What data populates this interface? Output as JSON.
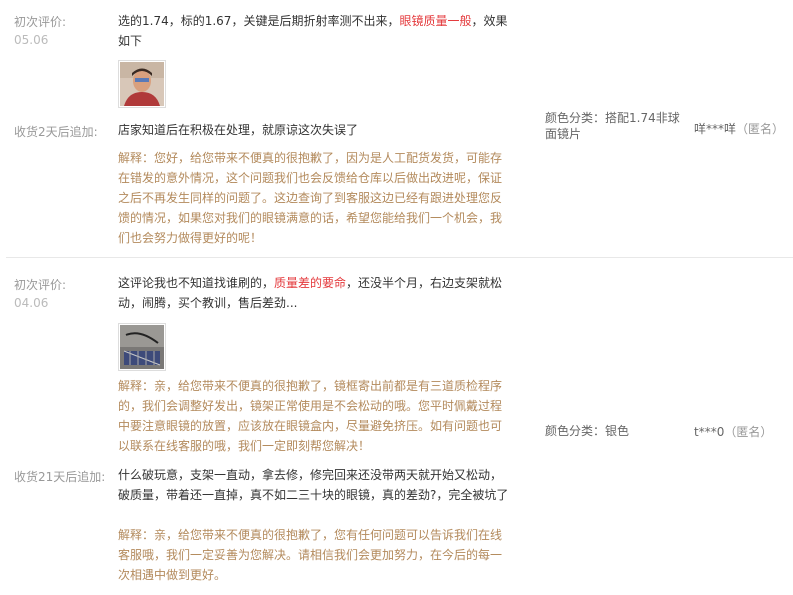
{
  "reviews": [
    {
      "initial_label": "初次评价:",
      "date": "05.06",
      "content_before": "选的1.74，标的1.67，关键是后期折射率测不出来，",
      "content_highlight": "眼镜质量一般",
      "content_after": "，效果如下",
      "followup_label": "收货2天后追加:",
      "followup_text": "店家知道后在积极在处理，就原谅这次失误了",
      "reply": "解释：您好，给您带来不便真的很抱歉了，因为是人工配货发货，可能存在错发的意外情况，这个问题我们也会反馈给仓库以后做出改进呢，保证之后不再发生同样的问题了。这边查询了到客服这边已经有跟进处理您反馈的情况，如果您对我们的眼镜满意的话，希望您能给我们一个机会，我们也会努力做得更好的呢！",
      "sku": "颜色分类：搭配1.74非球面镜片",
      "user": "咩***咩",
      "anon": "（匿名）"
    },
    {
      "initial_label": "初次评价:",
      "date": "04.06",
      "content_before": "这评论我也不知道找谁刷的，",
      "content_highlight": "质量差的要命",
      "content_after": "，还没半个月，右边支架就松动，闹腾，买个教训，售后差劲...",
      "reply": "解释：亲，给您带来不便真的很抱歉了，镜框寄出前都是有三道质检程序的，我们会调整好发出，镜架正常使用是不会松动的哦。您平时佩戴过程中要注意眼镜的放置，应该放在眼镜盒内，尽量避免挤压。如有问题也可以联系在线客服的哦，我们一定即刻帮您解决！",
      "followup_label": "收货21天后追加:",
      "followup_text": "什么破玩意，支架一直动，拿去修，修完回来还没带两天就开始又松动，破质量，带着还一直掉，真不如二三十块的眼镜，真的差劲?，完全被坑了",
      "followup_reply": "解释：亲，给您带来不便真的很抱歉了，您有任何问题可以告诉我们在线客服哦，我们一定妥善为您解决。请相信我们会更加努力，在今后的每一次相遇中做到更好。",
      "sku": "颜色分类：银色",
      "user": "t***0",
      "anon": "（匿名）"
    }
  ]
}
